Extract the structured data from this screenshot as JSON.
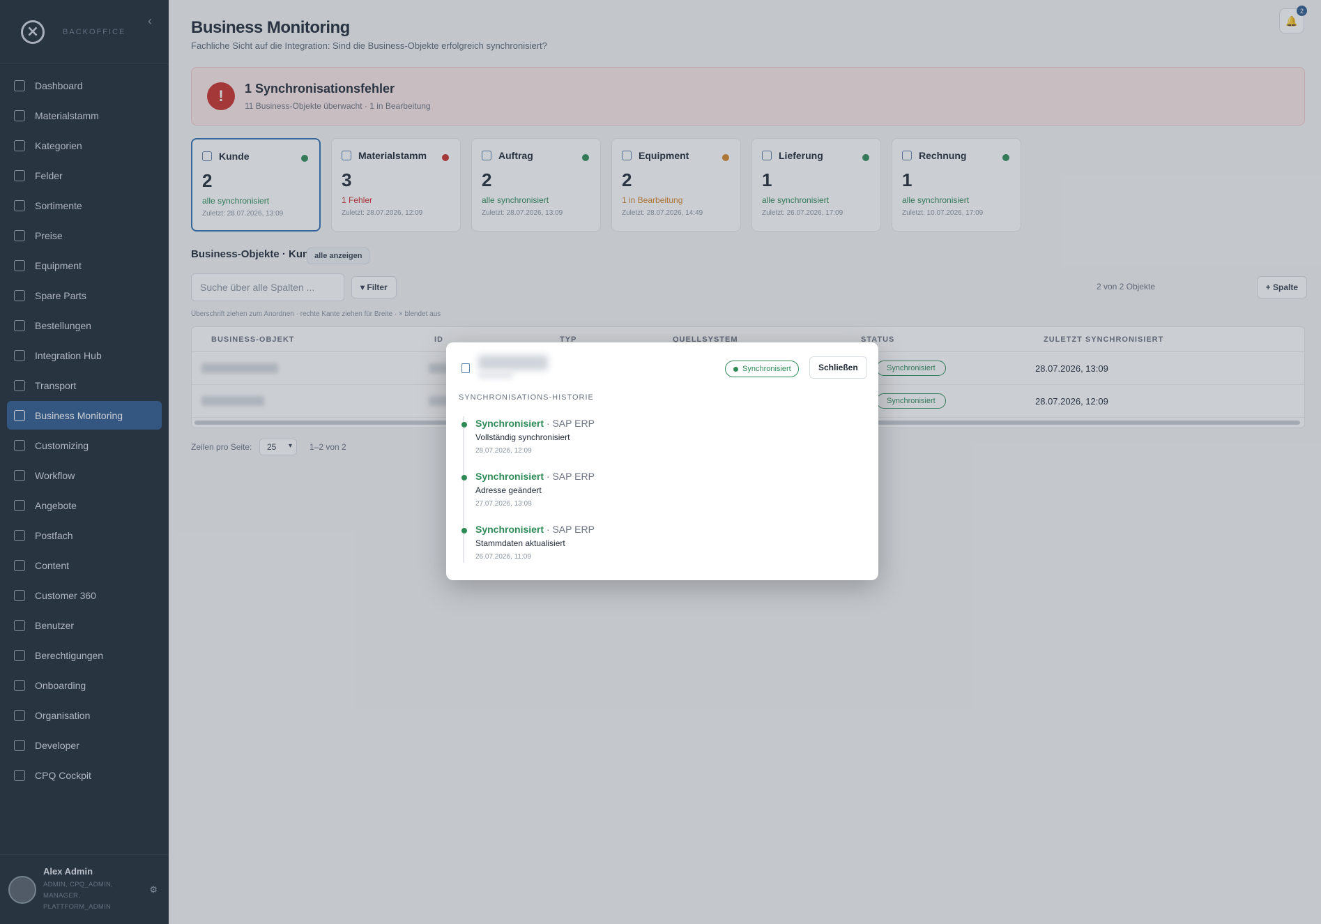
{
  "sidebar": {
    "brand": "BACKOFFICE",
    "items": [
      {
        "label": "Dashboard",
        "icon": "dashboard-icon"
      },
      {
        "label": "Materialstamm",
        "icon": "database-icon"
      },
      {
        "label": "Kategorien",
        "icon": "hierarchy-icon"
      },
      {
        "label": "Felder",
        "icon": "list-icon"
      },
      {
        "label": "Sortimente",
        "icon": "box-icon"
      },
      {
        "label": "Preise",
        "icon": "star-icon"
      },
      {
        "label": "Equipment",
        "icon": "monitor-icon"
      },
      {
        "label": "Spare Parts",
        "icon": "box-icon"
      },
      {
        "label": "Bestellungen",
        "icon": "cart-icon"
      },
      {
        "label": "Integration Hub",
        "icon": "bolt-icon"
      },
      {
        "label": "Transport",
        "icon": "truck-icon"
      },
      {
        "label": "Business Monitoring",
        "icon": "chat-icon"
      },
      {
        "label": "Customizing",
        "icon": "sliders-icon"
      },
      {
        "label": "Workflow",
        "icon": "workflow-icon"
      },
      {
        "label": "Angebote",
        "icon": "document-icon"
      },
      {
        "label": "Postfach",
        "icon": "bell-icon"
      },
      {
        "label": "Content",
        "icon": "megaphone-icon"
      },
      {
        "label": "Customer 360",
        "icon": "building-icon"
      },
      {
        "label": "Benutzer",
        "icon": "users-icon"
      },
      {
        "label": "Berechtigungen",
        "icon": "check-circle-icon"
      },
      {
        "label": "Onboarding",
        "icon": "user-plus-icon"
      },
      {
        "label": "Organisation",
        "icon": "org-icon"
      },
      {
        "label": "Developer",
        "icon": "code-icon"
      },
      {
        "label": "CPQ Cockpit",
        "icon": "sliders-icon"
      }
    ],
    "user": {
      "name": "Alex Admin",
      "roles": "ADMIN, CPQ_ADMIN, MANAGER, PLATTFORM_ADMIN"
    }
  },
  "header": {
    "title": "Business Monitoring",
    "subtitle": "Fachliche Sicht auf die Integration: Sind die Business-Objekte erfolgreich synchronisiert?",
    "notification_count": "2"
  },
  "alert": {
    "icon_text": "!",
    "title": "1 Synchronisationsfehler",
    "subtitle": "11 Business-Objekte überwacht · 1 in Bearbeitung"
  },
  "cards": [
    {
      "title": "Kunde",
      "count": "2",
      "status": "alle synchronisiert",
      "last": "Zuletzt: 28.07.2026, 13:09",
      "dot_color": "#2e8b57",
      "status_color": "#2e8b57"
    },
    {
      "title": "Materialstamm",
      "count": "3",
      "status": "1 Fehler",
      "last": "Zuletzt: 28.07.2026, 12:09",
      "dot_color": "#c9302c",
      "status_color": "#c9302c"
    },
    {
      "title": "Auftrag",
      "count": "2",
      "status": "alle synchronisiert",
      "last": "Zuletzt: 28.07.2026, 13:09",
      "dot_color": "#2e8b57",
      "status_color": "#2e8b57"
    },
    {
      "title": "Equipment",
      "count": "2",
      "status": "1 in Bearbeitung",
      "last": "Zuletzt: 28.07.2026, 14:49",
      "dot_color": "#d4862a",
      "status_color": "#d4862a"
    },
    {
      "title": "Lieferung",
      "count": "1",
      "status": "alle synchronisiert",
      "last": "Zuletzt: 26.07.2026, 17:09",
      "dot_color": "#2e8b57",
      "status_color": "#2e8b57"
    },
    {
      "title": "Rechnung",
      "count": "1",
      "status": "alle synchronisiert",
      "last": "Zuletzt: 10.07.2026, 17:09",
      "dot_color": "#2e8b57",
      "status_color": "#2e8b57"
    }
  ],
  "section": {
    "title": "Business-Objekte · Kunde",
    "show_all": "alle anzeigen"
  },
  "toolbar": {
    "search_placeholder": "Suche über alle Spalten ...",
    "filter_label": "▾ Filter",
    "count_text": "2 von 2 Objekte",
    "column_label": "+ Spalte",
    "hint": "Überschrift ziehen zum Anordnen · rechte Kante ziehen für Breite · × blendet aus"
  },
  "table": {
    "headers": [
      "BUSINESS-OBJEKT",
      "ID",
      "TYP",
      "QUELLSYSTEM",
      "STATUS",
      "ZULETZT SYNCHRONISIERT"
    ],
    "rows": [
      {
        "status": "Synchronisiert",
        "last": "28.07.2026, 13:09"
      },
      {
        "status": "Synchronisiert",
        "last": "28.07.2026, 12:09"
      }
    ]
  },
  "pagination": {
    "rows_label": "Zeilen pro Seite:",
    "rows_value": "25",
    "range": "1–2 von 2"
  },
  "modal": {
    "status": "Synchronisiert",
    "close_label": "Schließen",
    "section_label": "SYNCHRONISATIONS-HISTORIE",
    "history": [
      {
        "status": "Synchronisiert",
        "system": " · SAP ERP",
        "description": "Vollständig synchronisiert",
        "time": "28.07.2026, 12:09"
      },
      {
        "status": "Synchronisiert",
        "system": " · SAP ERP",
        "description": "Adresse geändert",
        "time": "27.07.2026, 13:09"
      },
      {
        "status": "Synchronisiert",
        "system": " · SAP ERP",
        "description": "Stammdaten aktualisiert",
        "time": "26.07.2026, 11:09"
      }
    ]
  }
}
